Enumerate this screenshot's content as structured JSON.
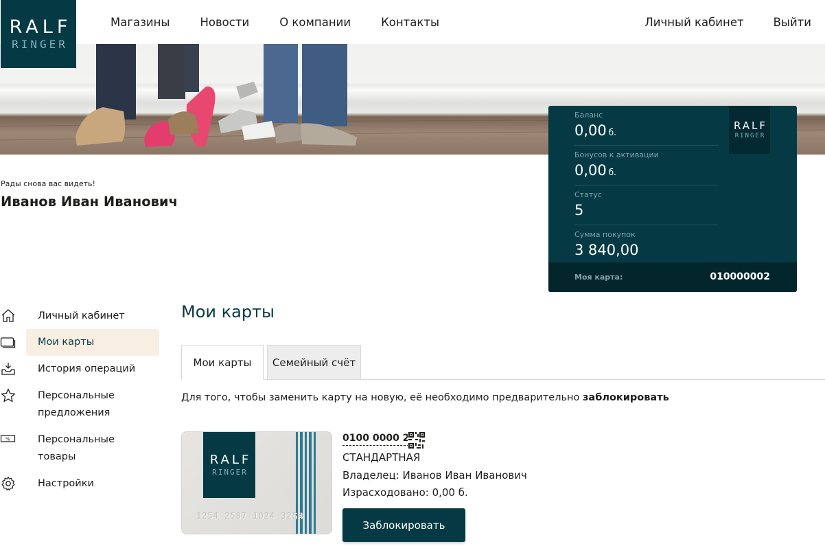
{
  "brand": {
    "logo_line1": "RALF",
    "logo_line2": "RINGER"
  },
  "nav": {
    "left": [
      "Магазины",
      "Новости",
      "О компании",
      "Контакты"
    ],
    "right": [
      "Личный кабинет",
      "Выйти"
    ]
  },
  "greeting": {
    "welcome": "Рады снова вас видеть!",
    "name": "Иванов Иван Иванович"
  },
  "panel": {
    "balance_label": "Баланс",
    "balance_value": "0,00",
    "balance_unit": "б.",
    "bonus_label": "Бонусов к активации",
    "bonus_value": "0,00",
    "bonus_unit": "б.",
    "status_label": "Статус",
    "status_value": "5",
    "purchases_label": "Сумма покупок",
    "purchases_value": "3 840,00",
    "card_label": "Моя карта:",
    "card_value": "010000002"
  },
  "sidebar": {
    "items": [
      {
        "label": "Личный кабинет",
        "icon": "home-icon"
      },
      {
        "label": "Мои карты",
        "icon": "cards-icon"
      },
      {
        "label": "История операций",
        "icon": "history-icon"
      },
      {
        "label": "Персональные предложения",
        "icon": "star-icon"
      },
      {
        "label": "Персональные товары",
        "icon": "discount-tag-icon"
      },
      {
        "label": "Настройки",
        "icon": "gear-icon"
      }
    ]
  },
  "main": {
    "title": "Мои карты",
    "tabs": [
      {
        "label": "Мои карты"
      },
      {
        "label": "Семейный счёт"
      }
    ],
    "notice_text": "Для того, чтобы заменить карту на новую, её необходимо предварительно ",
    "notice_bold": "заблокировать"
  },
  "card": {
    "printed_number": "1254 2587 1024 3254",
    "number": "0100 0000 2",
    "type": "СТАНДАРТНАЯ",
    "owner": "Владелец: Иванов Иван Иванович",
    "spent": "Израсходовано: 0,00 б.",
    "block_button": "Заблокировать"
  },
  "colors": {
    "primary": "#053a44",
    "accent_light": "#7fb2bd",
    "active_bg": "#f8efe2"
  }
}
